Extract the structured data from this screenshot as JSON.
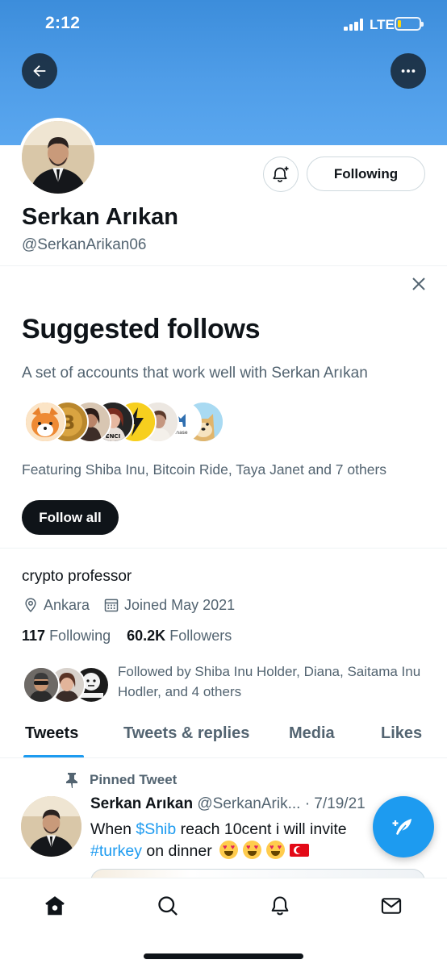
{
  "status_bar": {
    "time": "2:12",
    "network": "LTE",
    "battery_color": "#ffd60a"
  },
  "header": {
    "back_icon": "arrow-left-icon",
    "more_icon": "more-horizontal-icon",
    "banner_color": "#4f9de8"
  },
  "profile": {
    "display_name": "Serkan Arıkan",
    "handle": "@SerkanArikan06",
    "following_button": "Following",
    "bio": "crypto professor",
    "location": "Ankara",
    "joined": "Joined May 2021",
    "following_count": "117",
    "following_label": "Following",
    "followers_count": "60.2K",
    "followers_label": "Followers",
    "followed_by": "Followed by Shiba Inu Holder, Diana, Saitama Inu Hodler, and 4 others"
  },
  "suggested": {
    "title": "Suggested follows",
    "subtitle": "A set of accounts that work well with Serkan Arıkan",
    "featuring": "Featuring Shiba Inu, Bitcoin Ride, Taya Janet and 7 others",
    "follow_all": "Follow all",
    "avatar_icons": [
      "shiba-inu-avatar-icon",
      "bitcoin-avatar-icon",
      "person-avatar-icon",
      "person-avatar-icon",
      "lightning-avatar-icon",
      "person-avatar-icon",
      "chase-avatar-icon",
      "doge-avatar-icon"
    ],
    "chase_label": "i chase"
  },
  "tabs": [
    {
      "label": "Tweets",
      "active": true
    },
    {
      "label": "Tweets & replies",
      "active": false
    },
    {
      "label": "Media",
      "active": false
    },
    {
      "label": "Likes",
      "active": false
    }
  ],
  "pinned_tweet": {
    "pinned_label": "Pinned Tweet",
    "name": "Serkan Arıkan",
    "handle": "@SerkanArik...",
    "date": "· 7/19/21",
    "text_part1": "When ",
    "cashtag": "$Shib",
    "text_part2": " reach 10cent i will invite",
    "hashtag": "#turkey",
    "text_part3": " on dinner",
    "emoji_icons": [
      "heart-eyes-emoji-icon",
      "heart-eyes-emoji-icon",
      "heart-eyes-emoji-icon",
      "turkey-flag-icon"
    ]
  },
  "compose": {
    "icon": "compose-tweet-icon",
    "color": "#1d9bf0"
  },
  "bottom_nav": [
    "home-icon",
    "search-icon",
    "notifications-icon",
    "messages-icon"
  ],
  "colors": {
    "accent": "#1d9bf0",
    "text_primary": "#0f1419",
    "text_secondary": "#536471"
  }
}
